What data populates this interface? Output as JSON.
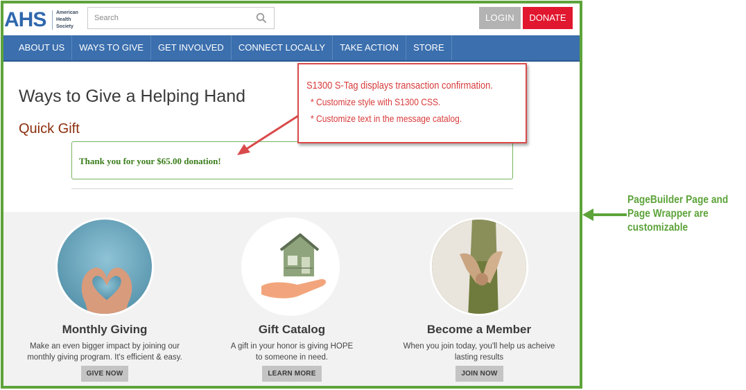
{
  "header": {
    "logo_mark": "AHS",
    "logo_text": [
      "American",
      "Health",
      "Society"
    ],
    "search_placeholder": "Search",
    "login_label": "LOGIN",
    "donate_label": "DONATE"
  },
  "nav": {
    "items": [
      "ABOUT US",
      "WAYS TO GIVE",
      "GET INVOLVED",
      "CONNECT LOCALLY",
      "TAKE ACTION",
      "STORE"
    ]
  },
  "content": {
    "title": "Ways to Give a Helping Hand",
    "section_title": "Quick Gift",
    "confirmation": "Thank you for your $65.00 donation!"
  },
  "features": [
    {
      "title": "Monthly Giving",
      "desc_line1": "Make an even bigger impact by joining our",
      "desc_line2": "monthly giving program. It's efficient & easy.",
      "button": "GIVE NOW"
    },
    {
      "title": "Gift Catalog",
      "desc_line1": "A gift in your honor is giving HOPE",
      "desc_line2": "to someone in need.",
      "button": "LEARN MORE"
    },
    {
      "title": "Become a Member",
      "desc_line1": "When you join today, you'll help us acheive",
      "desc_line2": "lasting results",
      "button": "JOIN NOW"
    }
  ],
  "annotations": {
    "callout_line1": "S1300 S-Tag displays transaction confirmation.",
    "callout_line2": "* Customize style with S1300 CSS.",
    "callout_line3": "* Customize text in the message catalog.",
    "side_note": [
      "PageBuilder Page and",
      "Page Wrapper are",
      "customizable"
    ]
  },
  "colors": {
    "nav_blue": "#3b6fae",
    "donate_red": "#e1172f",
    "wrapper_green": "#5da33a",
    "callout_red": "#d94a4a"
  }
}
